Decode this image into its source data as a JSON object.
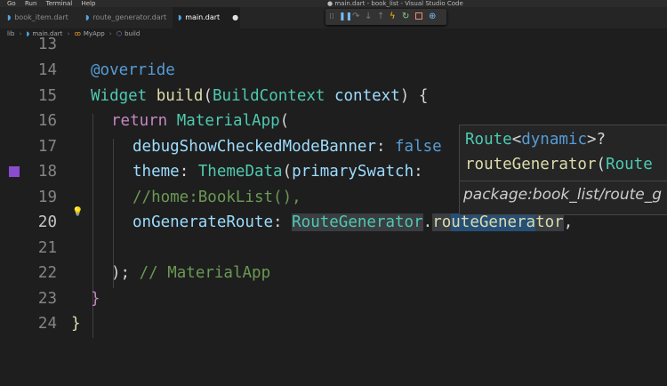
{
  "menubar": {
    "menus": [
      "Go",
      "Run",
      "Terminal",
      "Help"
    ],
    "window_title": "● main.dart - book_list - Visual Studio Code"
  },
  "tabs": [
    {
      "label": "book_item.dart",
      "active": false
    },
    {
      "label": "route_generator.dart",
      "active": false
    },
    {
      "label": "main.dart",
      "active": true,
      "modified": true
    }
  ],
  "debug_toolbar": {
    "icons": [
      "drag-grip-icon",
      "pause-icon",
      "step-over-icon",
      "step-into-icon",
      "step-out-icon",
      "hot-reload-icon",
      "restart-icon",
      "stop-icon",
      "inspect-widget-icon"
    ],
    "colors": {
      "enabled": "#75beff",
      "disabled": "#7a7a7a",
      "reload": "#ffc107",
      "restart": "#89d185",
      "stop": "#f48771"
    }
  },
  "breadcrumb": {
    "folder": "lib",
    "file": "main.dart",
    "class_name": "MyApp",
    "method": "build"
  },
  "editor": {
    "line_numbers": [
      "13",
      "14",
      "15",
      "16",
      "17",
      "18",
      "19",
      "20",
      "21",
      "22",
      "23",
      "24"
    ],
    "current_line": "20",
    "lines": {
      "l14": {
        "annotation": "@override"
      },
      "l15": {
        "type": "Widget",
        "fn": "build",
        "open": "(",
        "param_type": "BuildContext",
        "param": "context",
        "close": ") {"
      },
      "l16": {
        "kw": "return",
        "cls": "MaterialApp",
        "open": "("
      },
      "l17": {
        "prop": "debugShowCheckedModeBanner",
        "colon": ": ",
        "value": "false"
      },
      "l18": {
        "prop": "theme",
        "colon": ": ",
        "cls": "ThemeData",
        "open": "(",
        "prop2": "primarySwatch",
        "colon2": ": "
      },
      "l19": {
        "comment": "//home:BookList(),"
      },
      "l20": {
        "prop": "onGenerateRoute",
        "colon": ": ",
        "cls": "RouteGenerator",
        "dot": ".",
        "method_a": "ro",
        "method_b": "uteGenera",
        "method_c": "tor",
        "trail": ","
      },
      "l22": {
        "close": ");",
        "comment": " // MaterialApp"
      },
      "l23": {
        "brace": "}"
      },
      "l24": {
        "brace": "}"
      }
    }
  },
  "hover": {
    "ret_type": "Route",
    "lt": "<",
    "generic": "dynamic",
    "gt": ">?",
    "sig_name": "routeGenerator",
    "sig_open": "(",
    "sig_param": "Route",
    "package": "package:book_list/route_g"
  },
  "colors": {
    "breakpoint_marker": "#8a4bcf",
    "lightbulb": "#ffcc00"
  }
}
